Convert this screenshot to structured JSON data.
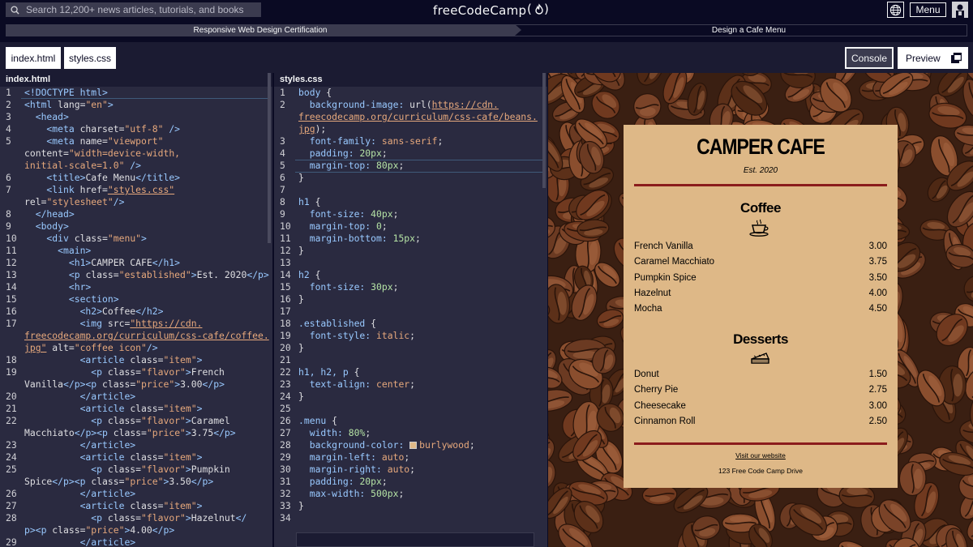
{
  "nav": {
    "search_placeholder": "Search 12,200+ news articles, tutorials, and books",
    "logo": "freeCodeCamp",
    "logo_flame": "(🔥)",
    "menu_label": "Menu"
  },
  "breadcrumb": {
    "course": "Responsive Web Design Certification",
    "project": "Design a Cafe Menu"
  },
  "tabs": [
    {
      "label": "index.html"
    },
    {
      "label": "styles.css"
    }
  ],
  "toolbar": {
    "console_label": "Console",
    "preview_label": "Preview"
  },
  "html_pane": {
    "title": "index.html",
    "lines": [
      {
        "n": "1",
        "segs": [
          [
            "k",
            "<!DOCTYPE html>"
          ]
        ]
      },
      {
        "n": "2",
        "segs": [
          [
            "k",
            "<html "
          ],
          [
            "p",
            "lang="
          ],
          [
            "s",
            "\"en\""
          ],
          [
            "k",
            ">"
          ]
        ]
      },
      {
        "n": "3",
        "segs": [
          [
            "k",
            "  <head>"
          ]
        ]
      },
      {
        "n": "4",
        "segs": [
          [
            "k",
            "    <meta "
          ],
          [
            "p",
            "charset="
          ],
          [
            "s",
            "\"utf-8\""
          ],
          [
            "k",
            " />"
          ]
        ]
      },
      {
        "n": "5",
        "segs": [
          [
            "k",
            "    <meta "
          ],
          [
            "p",
            "name="
          ],
          [
            "s",
            "\"viewport\""
          ]
        ]
      },
      {
        "n": "",
        "segs": [
          [
            "p",
            "content="
          ],
          [
            "s",
            "\"width=device-width,"
          ]
        ]
      },
      {
        "n": "",
        "segs": [
          [
            "s",
            "initial-scale=1.0\""
          ],
          [
            "k",
            " />"
          ]
        ]
      },
      {
        "n": "6",
        "segs": [
          [
            "k",
            "    <title>"
          ],
          [
            "p",
            "Cafe Menu"
          ],
          [
            "k",
            "</title>"
          ]
        ]
      },
      {
        "n": "7",
        "segs": [
          [
            "k",
            "    <link "
          ],
          [
            "p",
            "href="
          ],
          [
            "u",
            "\"styles.css\""
          ]
        ]
      },
      {
        "n": "",
        "segs": [
          [
            "p",
            "rel="
          ],
          [
            "s",
            "\"stylesheet\""
          ],
          [
            "k",
            "/>"
          ]
        ]
      },
      {
        "n": "8",
        "segs": [
          [
            "k",
            "  </head>"
          ]
        ]
      },
      {
        "n": "9",
        "segs": [
          [
            "k",
            "  <body>"
          ]
        ]
      },
      {
        "n": "10",
        "segs": [
          [
            "k",
            "    <div "
          ],
          [
            "p",
            "class="
          ],
          [
            "s",
            "\"menu\""
          ],
          [
            "k",
            ">"
          ]
        ]
      },
      {
        "n": "11",
        "segs": [
          [
            "k",
            "      <main>"
          ]
        ]
      },
      {
        "n": "12",
        "segs": [
          [
            "k",
            "        <h1>"
          ],
          [
            "p",
            "CAMPER CAFE"
          ],
          [
            "k",
            "</h1>"
          ]
        ]
      },
      {
        "n": "13",
        "segs": [
          [
            "k",
            "        <p "
          ],
          [
            "p",
            "class="
          ],
          [
            "s",
            "\"established\""
          ],
          [
            "k",
            ">"
          ],
          [
            "p",
            "Est. 2020"
          ],
          [
            "k",
            "</p>"
          ]
        ]
      },
      {
        "n": "14",
        "segs": [
          [
            "k",
            "        <hr>"
          ]
        ]
      },
      {
        "n": "15",
        "segs": [
          [
            "k",
            "        <section>"
          ]
        ]
      },
      {
        "n": "16",
        "segs": [
          [
            "k",
            "          <h2>"
          ],
          [
            "p",
            "Coffee"
          ],
          [
            "k",
            "</h2>"
          ]
        ]
      },
      {
        "n": "17",
        "segs": [
          [
            "k",
            "          <img "
          ],
          [
            "p",
            "src="
          ],
          [
            "u",
            "\"https://cdn."
          ]
        ]
      },
      {
        "n": "",
        "segs": [
          [
            "u",
            "freecodecamp.org/curriculum/css-cafe/coffee."
          ]
        ]
      },
      {
        "n": "",
        "segs": [
          [
            "u",
            "jpg\""
          ],
          [
            "p",
            " alt="
          ],
          [
            "s",
            "\"coffee icon\""
          ],
          [
            "k",
            "/>"
          ]
        ]
      },
      {
        "n": "18",
        "segs": [
          [
            "k",
            "          <article "
          ],
          [
            "p",
            "class="
          ],
          [
            "s",
            "\"item\""
          ],
          [
            "k",
            ">"
          ]
        ]
      },
      {
        "n": "19",
        "segs": [
          [
            "k",
            "            <p "
          ],
          [
            "p",
            "class="
          ],
          [
            "s",
            "\"flavor\""
          ],
          [
            "k",
            ">"
          ],
          [
            "p",
            "French"
          ]
        ]
      },
      {
        "n": "",
        "segs": [
          [
            "p",
            "Vanilla"
          ],
          [
            "k",
            "</p><p "
          ],
          [
            "p",
            "class="
          ],
          [
            "s",
            "\"price\""
          ],
          [
            "k",
            ">"
          ],
          [
            "p",
            "3.00"
          ],
          [
            "k",
            "</p>"
          ]
        ]
      },
      {
        "n": "20",
        "segs": [
          [
            "k",
            "          </article>"
          ]
        ]
      },
      {
        "n": "21",
        "segs": [
          [
            "k",
            "          <article "
          ],
          [
            "p",
            "class="
          ],
          [
            "s",
            "\"item\""
          ],
          [
            "k",
            ">"
          ]
        ]
      },
      {
        "n": "22",
        "segs": [
          [
            "k",
            "            <p "
          ],
          [
            "p",
            "class="
          ],
          [
            "s",
            "\"flavor\""
          ],
          [
            "k",
            ">"
          ],
          [
            "p",
            "Caramel"
          ]
        ]
      },
      {
        "n": "",
        "segs": [
          [
            "p",
            "Macchiato"
          ],
          [
            "k",
            "</p><p "
          ],
          [
            "p",
            "class="
          ],
          [
            "s",
            "\"price\""
          ],
          [
            "k",
            ">"
          ],
          [
            "p",
            "3.75"
          ],
          [
            "k",
            "</p>"
          ]
        ]
      },
      {
        "n": "23",
        "segs": [
          [
            "k",
            "          </article>"
          ]
        ]
      },
      {
        "n": "24",
        "segs": [
          [
            "k",
            "          <article "
          ],
          [
            "p",
            "class="
          ],
          [
            "s",
            "\"item\""
          ],
          [
            "k",
            ">"
          ]
        ]
      },
      {
        "n": "25",
        "segs": [
          [
            "k",
            "            <p "
          ],
          [
            "p",
            "class="
          ],
          [
            "s",
            "\"flavor\""
          ],
          [
            "k",
            ">"
          ],
          [
            "p",
            "Pumpkin"
          ]
        ]
      },
      {
        "n": "",
        "segs": [
          [
            "p",
            "Spice"
          ],
          [
            "k",
            "</p><p "
          ],
          [
            "p",
            "class="
          ],
          [
            "s",
            "\"price\""
          ],
          [
            "k",
            ">"
          ],
          [
            "p",
            "3.50"
          ],
          [
            "k",
            "</p>"
          ]
        ]
      },
      {
        "n": "26",
        "segs": [
          [
            "k",
            "          </article>"
          ]
        ]
      },
      {
        "n": "27",
        "segs": [
          [
            "k",
            "          <article "
          ],
          [
            "p",
            "class="
          ],
          [
            "s",
            "\"item\""
          ],
          [
            "k",
            ">"
          ]
        ]
      },
      {
        "n": "28",
        "segs": [
          [
            "k",
            "            <p "
          ],
          [
            "p",
            "class="
          ],
          [
            "s",
            "\"flavor\""
          ],
          [
            "k",
            ">"
          ],
          [
            "p",
            "Hazelnut"
          ],
          [
            "k",
            "</"
          ]
        ]
      },
      {
        "n": "",
        "segs": [
          [
            "k",
            "p><p "
          ],
          [
            "p",
            "class="
          ],
          [
            "s",
            "\"price\""
          ],
          [
            "k",
            ">"
          ],
          [
            "p",
            "4.00"
          ],
          [
            "k",
            "</p>"
          ]
        ]
      },
      {
        "n": "29",
        "segs": [
          [
            "k",
            "          </article>"
          ]
        ]
      }
    ]
  },
  "css_pane": {
    "title": "styles.css",
    "lines": [
      {
        "n": "1",
        "segs": [
          [
            "k",
            "body "
          ],
          [
            "p",
            "{"
          ]
        ]
      },
      {
        "n": "2",
        "segs": [
          [
            "k",
            "  background-image: "
          ],
          [
            "p",
            "url("
          ],
          [
            "u",
            "https://cdn."
          ]
        ]
      },
      {
        "n": "",
        "segs": [
          [
            "u",
            "freecodecamp.org/curriculum/css-cafe/beans."
          ]
        ]
      },
      {
        "n": "",
        "segs": [
          [
            "u",
            "jpg"
          ],
          [
            "p",
            ");"
          ]
        ]
      },
      {
        "n": "3",
        "segs": [
          [
            "k",
            "  font-family: "
          ],
          [
            "s",
            "sans-serif"
          ],
          [
            "p",
            ";"
          ]
        ]
      },
      {
        "n": "4",
        "segs": [
          [
            "k",
            "  padding: "
          ],
          [
            "n",
            "20px"
          ],
          [
            "p",
            ";"
          ]
        ]
      },
      {
        "n": "5",
        "segs": [
          [
            "k",
            "  margin-top: "
          ],
          [
            "n",
            "80px"
          ],
          [
            "p",
            ";"
          ]
        ]
      },
      {
        "n": "6",
        "segs": [
          [
            "p",
            "}"
          ]
        ]
      },
      {
        "n": "7",
        "segs": []
      },
      {
        "n": "8",
        "segs": [
          [
            "k",
            "h1 "
          ],
          [
            "p",
            "{"
          ]
        ]
      },
      {
        "n": "9",
        "segs": [
          [
            "k",
            "  font-size: "
          ],
          [
            "n",
            "40px"
          ],
          [
            "p",
            ";"
          ]
        ]
      },
      {
        "n": "10",
        "segs": [
          [
            "k",
            "  margin-top: "
          ],
          [
            "n",
            "0"
          ],
          [
            "p",
            ";"
          ]
        ]
      },
      {
        "n": "11",
        "segs": [
          [
            "k",
            "  margin-bottom: "
          ],
          [
            "n",
            "15px"
          ],
          [
            "p",
            ";"
          ]
        ]
      },
      {
        "n": "12",
        "segs": [
          [
            "p",
            "}"
          ]
        ]
      },
      {
        "n": "13",
        "segs": []
      },
      {
        "n": "14",
        "segs": [
          [
            "k",
            "h2 "
          ],
          [
            "p",
            "{"
          ]
        ]
      },
      {
        "n": "15",
        "segs": [
          [
            "k",
            "  font-size: "
          ],
          [
            "n",
            "30px"
          ],
          [
            "p",
            ";"
          ]
        ]
      },
      {
        "n": "16",
        "segs": [
          [
            "p",
            "}"
          ]
        ]
      },
      {
        "n": "17",
        "segs": []
      },
      {
        "n": "18",
        "segs": [
          [
            "k",
            ".established "
          ],
          [
            "p",
            "{"
          ]
        ]
      },
      {
        "n": "19",
        "segs": [
          [
            "k",
            "  font-style: "
          ],
          [
            "s",
            "italic"
          ],
          [
            "p",
            ";"
          ]
        ]
      },
      {
        "n": "20",
        "segs": [
          [
            "p",
            "}"
          ]
        ]
      },
      {
        "n": "21",
        "segs": []
      },
      {
        "n": "22",
        "segs": [
          [
            "k",
            "h1, h2, p "
          ],
          [
            "p",
            "{"
          ]
        ]
      },
      {
        "n": "23",
        "segs": [
          [
            "k",
            "  text-align: "
          ],
          [
            "s",
            "center"
          ],
          [
            "p",
            ";"
          ]
        ]
      },
      {
        "n": "24",
        "segs": [
          [
            "p",
            "}"
          ]
        ]
      },
      {
        "n": "25",
        "segs": []
      },
      {
        "n": "26",
        "segs": [
          [
            "k",
            ".menu "
          ],
          [
            "p",
            "{"
          ]
        ]
      },
      {
        "n": "27",
        "segs": [
          [
            "k",
            "  width: "
          ],
          [
            "n",
            "80%"
          ],
          [
            "p",
            ";"
          ]
        ]
      },
      {
        "n": "28",
        "segs": [
          [
            "k",
            "  background-color: "
          ],
          [
            "sw",
            "#deb887"
          ],
          [
            "s",
            "burlywood"
          ],
          [
            "p",
            ";"
          ]
        ]
      },
      {
        "n": "29",
        "segs": [
          [
            "k",
            "  margin-left: "
          ],
          [
            "s",
            "auto"
          ],
          [
            "p",
            ";"
          ]
        ]
      },
      {
        "n": "30",
        "segs": [
          [
            "k",
            "  margin-right: "
          ],
          [
            "s",
            "auto"
          ],
          [
            "p",
            ";"
          ]
        ]
      },
      {
        "n": "31",
        "segs": [
          [
            "k",
            "  padding: "
          ],
          [
            "n",
            "20px"
          ],
          [
            "p",
            ";"
          ]
        ]
      },
      {
        "n": "32",
        "segs": [
          [
            "k",
            "  max-width: "
          ],
          [
            "n",
            "500px"
          ],
          [
            "p",
            ";"
          ]
        ]
      },
      {
        "n": "33",
        "segs": [
          [
            "p",
            "}"
          ]
        ]
      },
      {
        "n": "34",
        "segs": []
      }
    ]
  },
  "preview": {
    "title": "CAMPER CAFE",
    "established": "Est. 2020",
    "coffee": {
      "heading": "Coffee",
      "items": [
        {
          "flavor": "French Vanilla",
          "price": "3.00"
        },
        {
          "flavor": "Caramel Macchiato",
          "price": "3.75"
        },
        {
          "flavor": "Pumpkin Spice",
          "price": "3.50"
        },
        {
          "flavor": "Hazelnut",
          "price": "4.00"
        },
        {
          "flavor": "Mocha",
          "price": "4.50"
        }
      ]
    },
    "desserts": {
      "heading": "Desserts",
      "items": [
        {
          "flavor": "Donut",
          "price": "1.50"
        },
        {
          "flavor": "Cherry Pie",
          "price": "2.75"
        },
        {
          "flavor": "Cheesecake",
          "price": "3.00"
        },
        {
          "flavor": "Cinnamon Roll",
          "price": "2.50"
        }
      ]
    },
    "footer_link": "Visit our website",
    "address": "123 Free Code Camp Drive"
  },
  "colors": {
    "nav_bg": "#0a0a23",
    "editor_bg": "#2a2a40",
    "menu_bg": "#deb887",
    "rule": "#8b1c1c",
    "keyword": "#99c9ff",
    "string": "#e6a87c",
    "number": "#b5e3a5"
  }
}
